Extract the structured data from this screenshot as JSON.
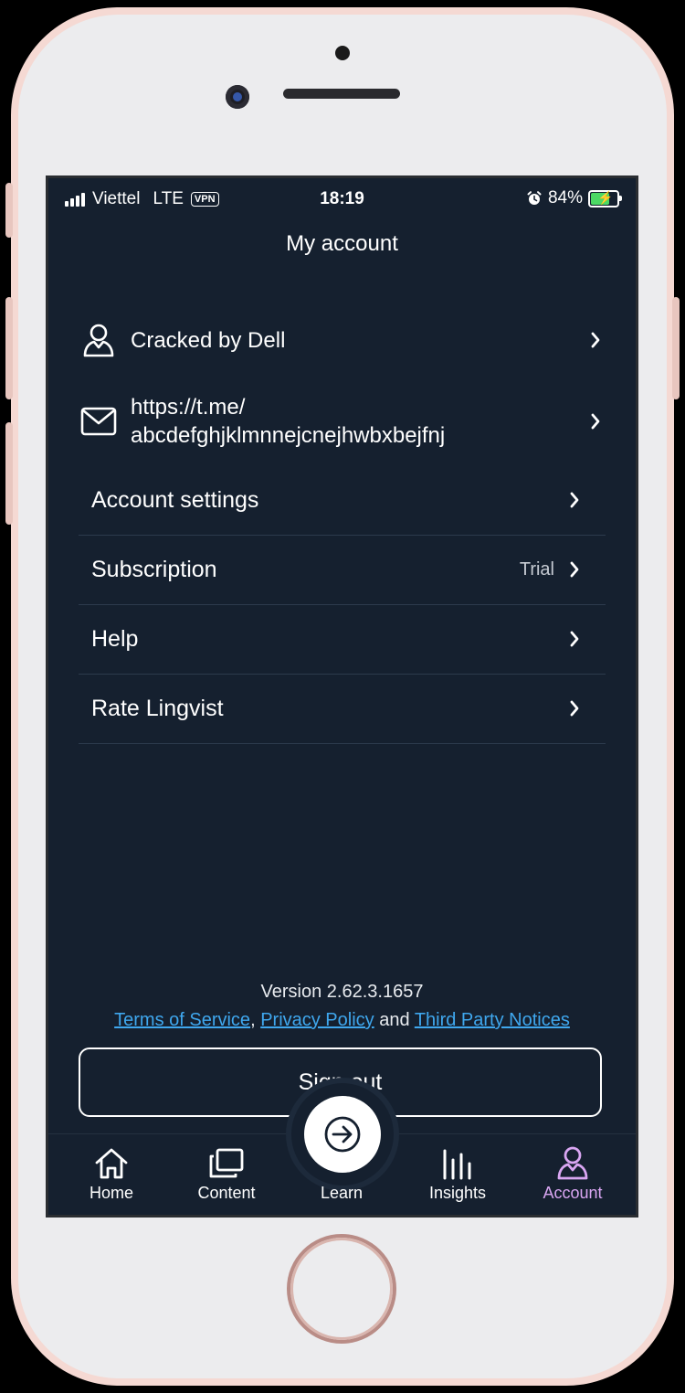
{
  "status_bar": {
    "carrier": "Viettel",
    "network": "LTE",
    "vpn": "VPN",
    "time": "18:19",
    "battery": "84%",
    "battery_level": 0.84
  },
  "header": {
    "title": "My account"
  },
  "profile": {
    "name": "Cracked by Dell",
    "email_line1": "https://t.me/",
    "email_line2": "abcdefghjklmnnejcnejhwbxbejfnj"
  },
  "menu": {
    "items": [
      {
        "label": "Account settings",
        "value": ""
      },
      {
        "label": "Subscription",
        "value": "Trial"
      },
      {
        "label": "Help",
        "value": ""
      },
      {
        "label": "Rate Lingvist",
        "value": ""
      }
    ]
  },
  "footer": {
    "version": "Version 2.62.3.1657",
    "terms": "Terms of Service",
    "comma": ",",
    "privacy": "Privacy Policy",
    "and": "and",
    "third_party": "Third Party Notices",
    "signout_label": "Sign out"
  },
  "tabbar": {
    "tabs": [
      {
        "label": "Home",
        "icon": "home-icon"
      },
      {
        "label": "Content",
        "icon": "content-icon"
      },
      {
        "label": "Learn",
        "icon": "learn-arrow-icon"
      },
      {
        "label": "Insights",
        "icon": "insights-icon"
      },
      {
        "label": "Account",
        "icon": "account-icon",
        "active": true
      }
    ],
    "active_color": "#d9a6f2"
  },
  "colors": {
    "background": "#15202f",
    "link": "#3fa7ee",
    "divider": "#2c3a4c"
  }
}
